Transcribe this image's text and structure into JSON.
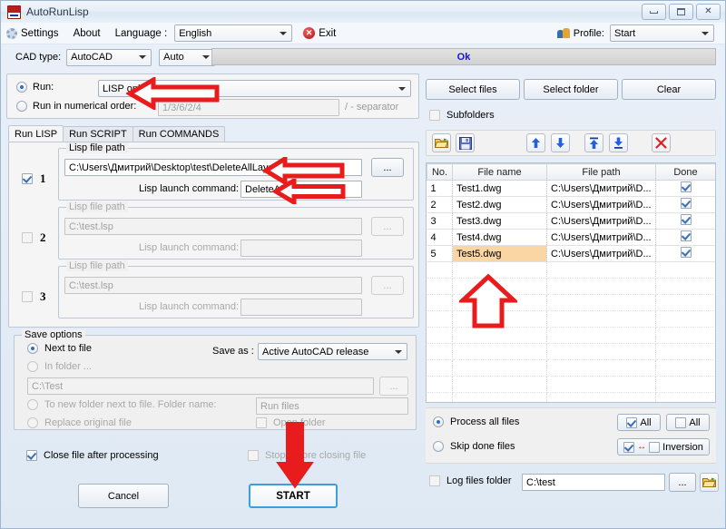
{
  "window": {
    "title": "AutoRunLisp",
    "icon": "app-icon",
    "minimize": "minimize",
    "maximize": "maximize",
    "close": "close"
  },
  "menu": {
    "settings": "Settings",
    "about": "About",
    "language_label": "Language :",
    "language_value": "English",
    "exit": "Exit",
    "exit_glyph": "✕",
    "profile_label": "Profile:",
    "profile_value": "Start"
  },
  "cad": {
    "type_label": "CAD type:",
    "type_value": "AutoCAD",
    "mode_value": "Auto",
    "status": "Ok"
  },
  "run": {
    "run_label": "Run:",
    "run_mode": "LISP only",
    "numeric_label": "Run in numerical order:",
    "numeric_value": "1/3/6/2/4",
    "separator_note": "/ - separator"
  },
  "tabs": [
    {
      "label": "Run LISP",
      "active": true
    },
    {
      "label": "Run SCRIPT",
      "active": false
    },
    {
      "label": "Run COMMANDS",
      "active": false
    }
  ],
  "lisp_entries": [
    {
      "num": "1",
      "enabled": true,
      "path_group_title": "Lisp file path",
      "path": "C:\\Users\\Дмитрий\\Desktop\\test\\DeleteAllLayout.lsp",
      "browse": "...",
      "cmd_label": "Lisp launch command:",
      "cmd": "DeleteAllLayout"
    },
    {
      "num": "2",
      "enabled": false,
      "path_group_title": "Lisp file path",
      "path": "C:\\test.lsp",
      "browse": "...",
      "cmd_label": "Lisp launch command:",
      "cmd": ""
    },
    {
      "num": "3",
      "enabled": false,
      "path_group_title": "Lisp file path",
      "path": "C:\\test.lsp",
      "browse": "...",
      "cmd_label": "Lisp launch command:",
      "cmd": ""
    }
  ],
  "save_options": {
    "title": "Save options",
    "next_to_file": "Next to file",
    "in_folder": "In folder ...",
    "folder_path": "C:\\Test",
    "folder_browse": "...",
    "new_folder": "To new folder next to file. Folder name:",
    "new_folder_value": "Run files",
    "replace_original": "Replace original file",
    "open_folder": "Open folder",
    "save_as_label": "Save as :",
    "save_as_value": "Active AutoCAD release"
  },
  "bottom_left": {
    "close_after": "Close file after processing",
    "stop_before": "Stop before closing file",
    "cancel": "Cancel",
    "start": "START"
  },
  "files_panel": {
    "select_files": "Select files",
    "select_folder": "Select folder",
    "clear": "Clear",
    "subfolders": "Subfolders",
    "toolbar": [
      {
        "name": "open-folder-icon"
      },
      {
        "name": "save-icon"
      },
      {
        "name": "move-up-icon"
      },
      {
        "name": "move-down-icon"
      },
      {
        "name": "move-top-icon"
      },
      {
        "name": "move-bottom-icon"
      },
      {
        "name": "delete-icon"
      }
    ],
    "columns": [
      "No.",
      "File name",
      "File path",
      "Done"
    ],
    "rows": [
      {
        "no": "1",
        "name": "Test1.dwg",
        "path": "C:\\Users\\Дмитрий\\D...",
        "done": true,
        "selected": false
      },
      {
        "no": "2",
        "name": "Test2.dwg",
        "path": "C:\\Users\\Дмитрий\\D...",
        "done": true,
        "selected": false
      },
      {
        "no": "3",
        "name": "Test3.dwg",
        "path": "C:\\Users\\Дмитрий\\D...",
        "done": true,
        "selected": false
      },
      {
        "no": "4",
        "name": "Test4.dwg",
        "path": "C:\\Users\\Дмитрий\\D...",
        "done": true,
        "selected": false
      },
      {
        "no": "5",
        "name": "Test5.dwg",
        "path": "C:\\Users\\Дмитрий\\D...",
        "done": true,
        "selected": true
      }
    ],
    "process_all": "Process all files",
    "skip_done": "Skip done files",
    "check_all": "All",
    "uncheck_all": "All",
    "inversion": "Inversion",
    "log_files_folder": "Log files folder",
    "log_path": "C:\\test",
    "log_browse": "..."
  },
  "colors": {
    "accent_blue": "#1414dd",
    "arrow_red": "#e81c1c",
    "selected_row": "#fad6a5",
    "start_border": "#3c9fd8"
  }
}
